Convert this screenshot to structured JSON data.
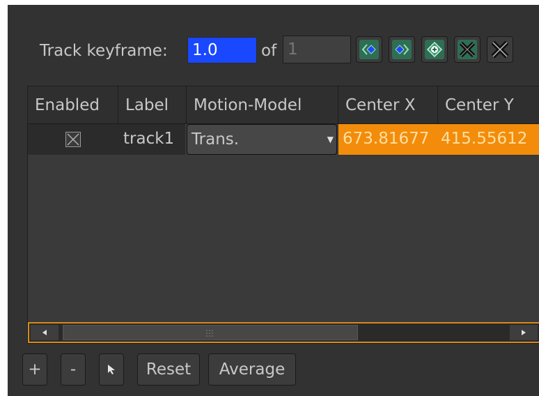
{
  "keyframe": {
    "label": "Track keyframe:",
    "current": "1.0",
    "of_label": "of",
    "total": "1",
    "buttons": [
      {
        "name": "previous-keyframe-icon"
      },
      {
        "name": "next-keyframe-icon"
      },
      {
        "name": "add-keyframe-icon"
      },
      {
        "name": "remove-keyframe-icon"
      },
      {
        "name": "clear-keyframes-icon"
      }
    ]
  },
  "table": {
    "columns": [
      "Enabled",
      "Label",
      "Motion-Model",
      "Center X",
      "Center Y"
    ],
    "rows": [
      {
        "enabled": true,
        "label": "track1",
        "motion_model": "Trans.",
        "center_x": "673.81677",
        "center_y": "415.55612"
      }
    ]
  },
  "bottom_buttons": {
    "add": "+",
    "remove": "-",
    "select": "select-pointer-icon",
    "reset": "Reset",
    "average": "Average"
  },
  "colors": {
    "panel_bg": "#323232",
    "selection_blue": "#1a48ff",
    "highlight_orange": "#f28c0a",
    "text": "#c8c8c8",
    "keyframe_icon_green": "#3d9a6f"
  }
}
